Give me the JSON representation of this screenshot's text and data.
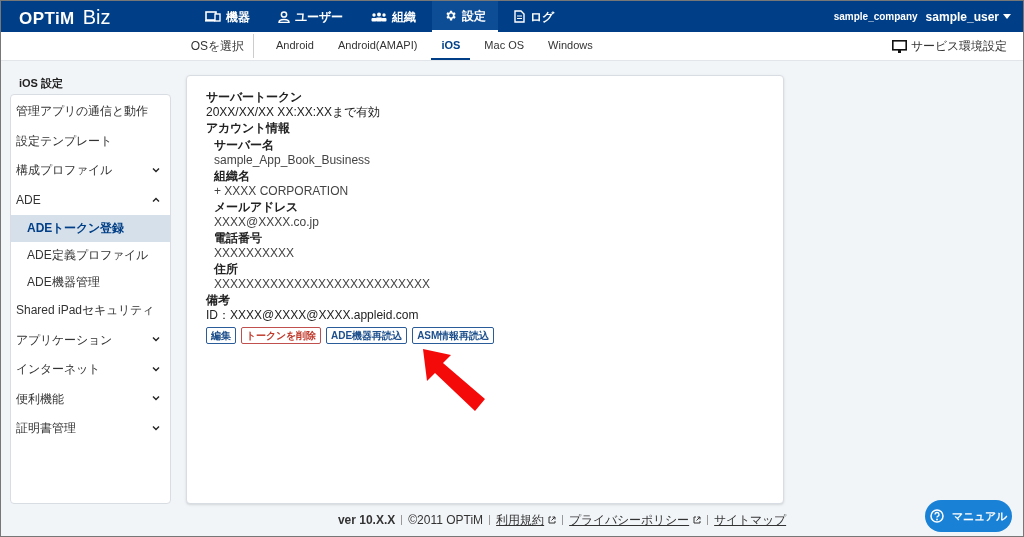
{
  "header": {
    "logo": "OPTiM",
    "logo_suffix": "Biz",
    "nav": [
      {
        "label": "機器",
        "selected": false
      },
      {
        "label": "ユーザー",
        "selected": false
      },
      {
        "label": "組織",
        "selected": false
      },
      {
        "label": "設定",
        "selected": true
      },
      {
        "label": "ログ",
        "selected": false
      }
    ],
    "company": "sample_company",
    "user": "sample_user"
  },
  "os_bar": {
    "label": "OSを選択",
    "tabs": [
      {
        "label": "Android",
        "selected": false
      },
      {
        "label": "Android(AMAPI)",
        "selected": false
      },
      {
        "label": "iOS",
        "selected": true
      },
      {
        "label": "Mac OS",
        "selected": false
      },
      {
        "label": "Windows",
        "selected": false
      }
    ],
    "service_settings": "サービス環境設定"
  },
  "sidebar": {
    "title": "iOS 設定",
    "items": [
      {
        "label": "管理アプリの通信と動作",
        "selected": false
      },
      {
        "label": "設定テンプレート",
        "selected": false
      },
      {
        "label": "構成プロファイル",
        "selected": false,
        "expanded": false
      },
      {
        "label": "ADE",
        "selected": false,
        "expanded": true,
        "children": [
          {
            "label": "ADEトークン登録",
            "selected": true
          },
          {
            "label": "ADE定義プロファイル",
            "selected": false
          },
          {
            "label": "ADE機器管理",
            "selected": false
          }
        ]
      },
      {
        "label": "Shared iPadセキュリティ",
        "selected": false
      },
      {
        "label": "アプリケーション",
        "selected": false,
        "expanded": false
      },
      {
        "label": "インターネット",
        "selected": false,
        "expanded": false
      },
      {
        "label": "便利機能",
        "selected": false,
        "expanded": false
      },
      {
        "label": "証明書管理",
        "selected": false,
        "expanded": false
      }
    ]
  },
  "detail": {
    "fields": [
      {
        "label": "サーバートークン",
        "value": "20XX/XX/XX XX:XX:XXまで有効"
      },
      {
        "label": "アカウント情報",
        "children": [
          {
            "label": "サーバー名",
            "value": "sample_App_Book_Business"
          },
          {
            "label": "組織名",
            "value": "+ XXXX CORPORATION"
          },
          {
            "label": "メールアドレス",
            "value": "XXXX@XXXX.co.jp"
          },
          {
            "label": "電話番号",
            "value": "XXXXXXXXXX"
          },
          {
            "label": "住所",
            "value": "XXXXXXXXXXXXXXXXXXXXXXXXXXX"
          }
        ]
      },
      {
        "label": "備考",
        "value": "ID：XXXX@XXXX@XXXX.appleid.com"
      }
    ],
    "buttons": [
      {
        "label": "編集",
        "kind": "normal"
      },
      {
        "label": "トークンを削除",
        "kind": "danger"
      },
      {
        "label": "ADE機器再読込",
        "kind": "normal"
      },
      {
        "label": "ASM情報再読込",
        "kind": "normal"
      }
    ]
  },
  "annotation": {
    "kind": "arrow"
  },
  "footer": {
    "items": [
      {
        "label": "ver 10.X.X",
        "kind": "text"
      },
      {
        "label": "©2011 OPTiM",
        "kind": "text"
      },
      {
        "label": "利用規約",
        "kind": "external"
      },
      {
        "label": "プライバシーポリシー",
        "kind": "external"
      },
      {
        "label": "サイトマップ",
        "kind": "link"
      }
    ]
  },
  "manual_button": {
    "label": "マニュアル"
  }
}
